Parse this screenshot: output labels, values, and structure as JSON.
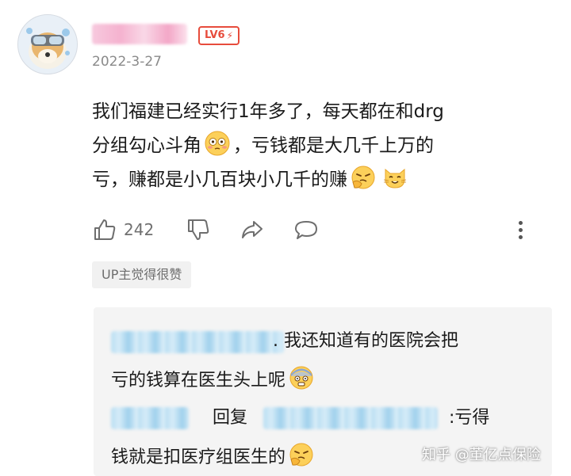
{
  "comment": {
    "level": "LV6",
    "date": "2022-3-27",
    "text_line1": "我们福建已经实行1年多了，每天都在和drg",
    "text_line2a": "分组勾心斗角",
    "text_line2b": "，亏钱都是大几千上万的",
    "text_line3": "亏，赚都是小几百块小几千的赚",
    "like_count": "242",
    "up_tag": "UP主觉得很赞"
  },
  "replies": {
    "first_line1": ". 我还知道有的医院会把",
    "first_line2": "亏的钱算在医生头上呢",
    "second_reply_word": "回复",
    "second_line1_tail": ":亏得",
    "second_line2": "钱就是扣医疗组医生的"
  },
  "watermark": "知乎 @董亿点保险",
  "icons": [
    "avatar",
    "level-bolt-icon",
    "flushed-emoji-icon",
    "thinking-emoji-icon",
    "cat-emoji-icon",
    "thumbs-up-icon",
    "thumbs-down-icon",
    "share-icon",
    "comment-icon",
    "more-icon",
    "scared-emoji-icon"
  ],
  "colors": {
    "level_red": "#e74c3c",
    "meta_gray": "#8a8a8a",
    "reply_bg": "#f4f4f4"
  }
}
